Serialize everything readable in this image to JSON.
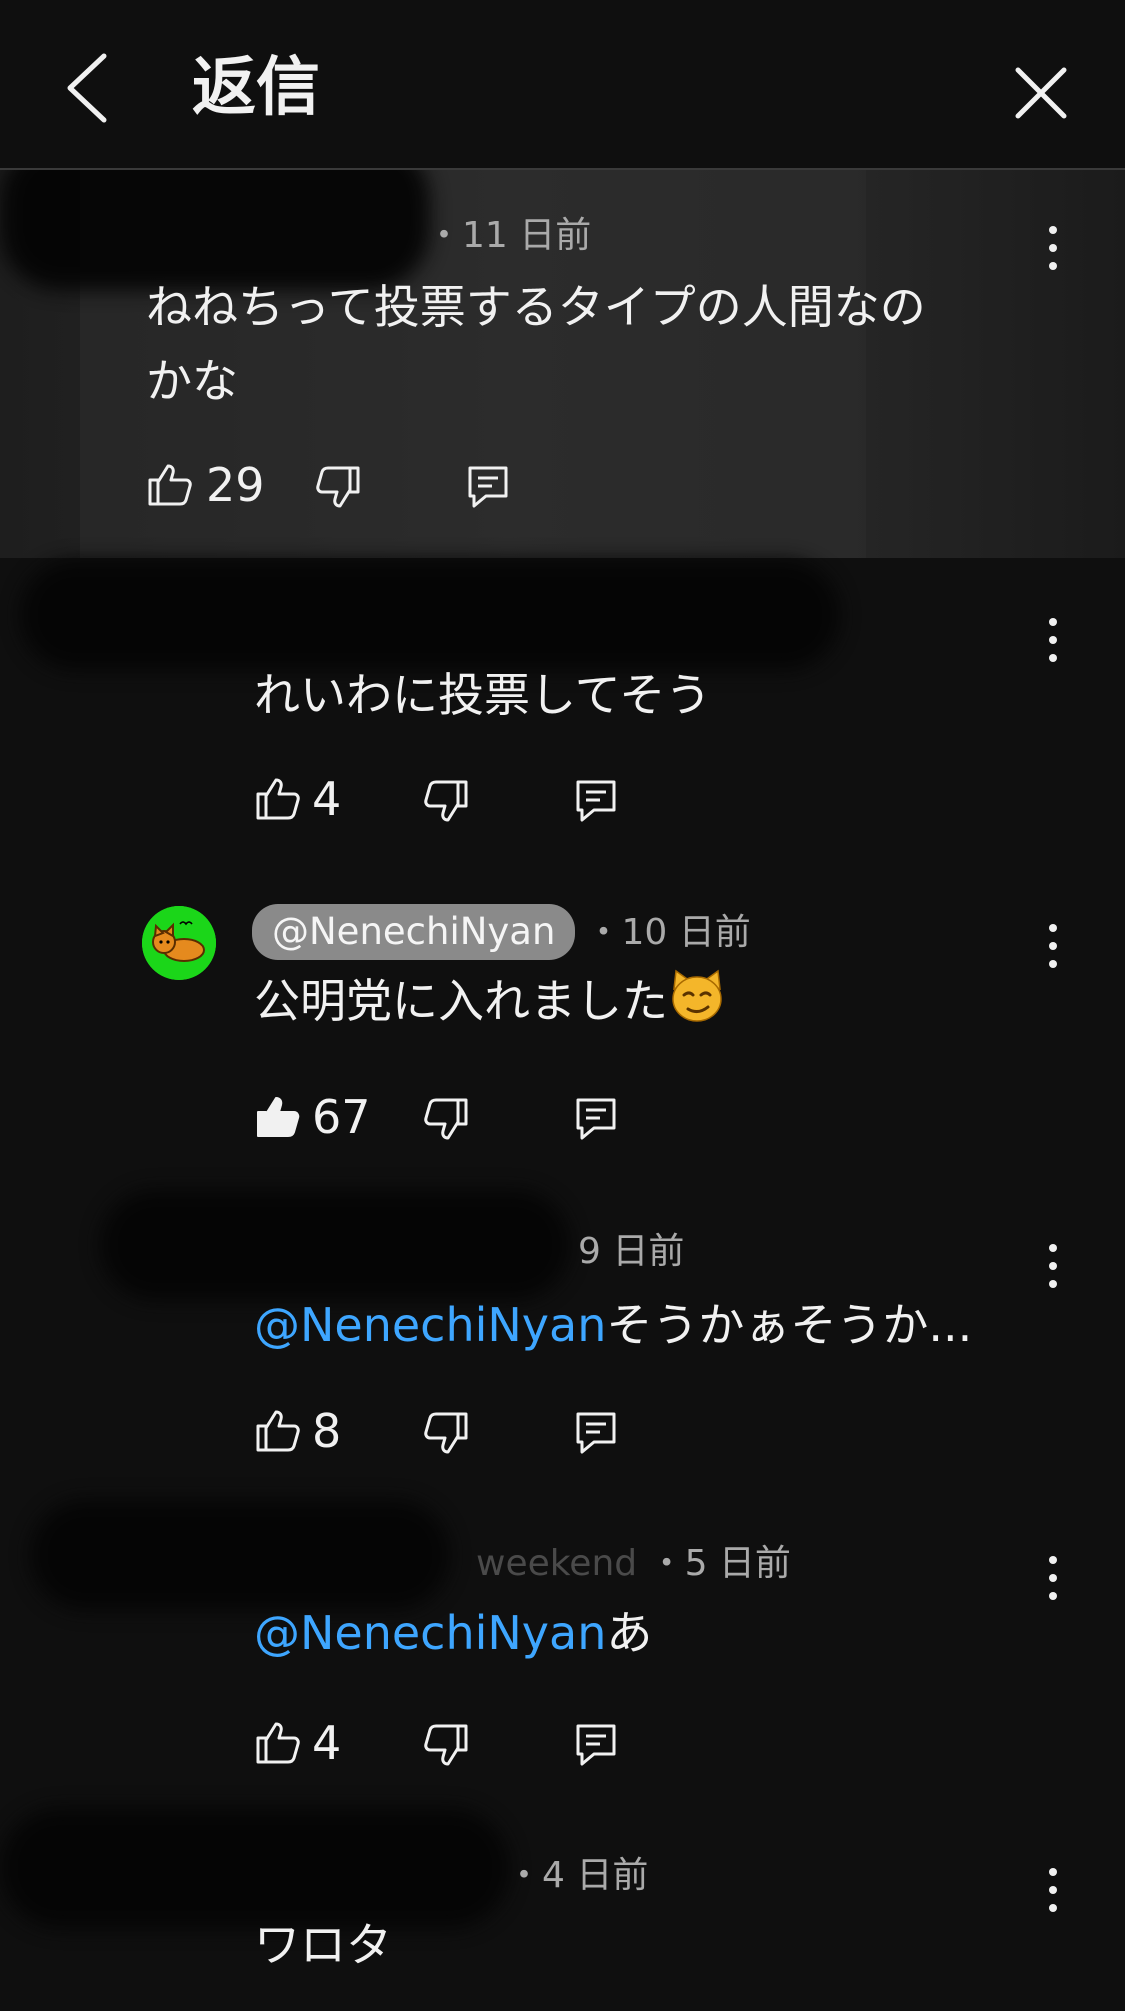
{
  "header": {
    "title": "返信"
  },
  "comments": [
    {
      "timestamp": "・11 日前",
      "text_line1": "ねねちって投票するタイプの人間なの",
      "text_line2": "かな",
      "likes": "29"
    },
    {
      "text": "れいわに投票してそう",
      "likes": "4"
    },
    {
      "handle": "@NenechiNyan",
      "timestamp": "・10 日前",
      "text": "公明党に入れました",
      "likes": "67",
      "liked": true
    },
    {
      "timestamp": "9 日前",
      "mention": "@NenechiNyan",
      "text": "そうかぁそうか...",
      "likes": "8"
    },
    {
      "author_partial": "weekend",
      "timestamp": "・5 日前",
      "mention": "@NenechiNyan",
      "text": "あ",
      "likes": "4"
    },
    {
      "timestamp": "・4 日前",
      "text": "ワロタ"
    }
  ],
  "colors": {
    "background": "#0f0f0f",
    "mention": "#3ea6ff",
    "avatar_bg": "#1bd619"
  }
}
